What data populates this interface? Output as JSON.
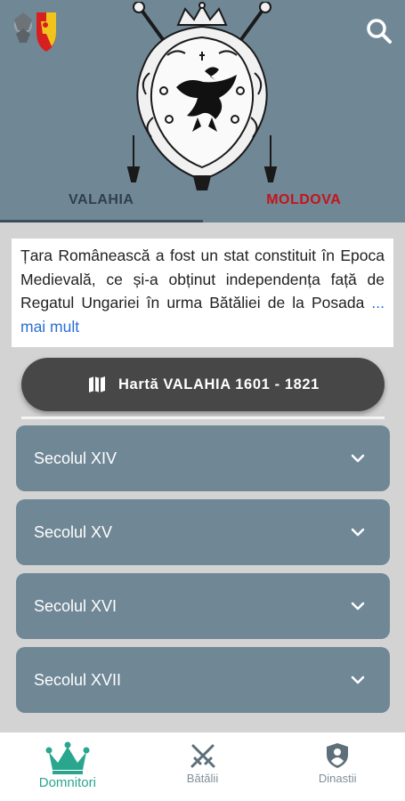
{
  "header": {
    "search_icon": "search-icon",
    "logo_icon": "romanian-coat-of-arms-icon",
    "emblem_icon": "wallachia-eagle-coat-of-arms",
    "background_color": "#708796"
  },
  "tabs": [
    {
      "label": "VALAHIA",
      "active": true,
      "color": "#2f3f4a"
    },
    {
      "label": "MOLDOVA",
      "active": false,
      "color": "#c3141b"
    }
  ],
  "intro": {
    "text": "Țara Românească a fost un stat constituit în Epoca Medievală, ce și-a obținut independența față de Regatul Ungariei în urma Bătăliei de la Posada",
    "more_link": " ... mai mult"
  },
  "map_button": {
    "icon": "map-icon",
    "label": "Hartă VALAHIA 1601 - 1821"
  },
  "centuries": [
    {
      "label": "Secolul XIV"
    },
    {
      "label": "Secolul XV"
    },
    {
      "label": "Secolul XVI"
    },
    {
      "label": "Secolul XVII"
    }
  ],
  "bottom_nav": [
    {
      "label": "Domnitori",
      "icon": "crown-icon",
      "active": true,
      "color": "#2aa68f"
    },
    {
      "label": "Bătălii",
      "icon": "crossed-swords-icon",
      "active": false,
      "color": "#7e8f99"
    },
    {
      "label": "Dinastii",
      "icon": "shield-person-icon",
      "active": false,
      "color": "#7e8f99"
    }
  ]
}
